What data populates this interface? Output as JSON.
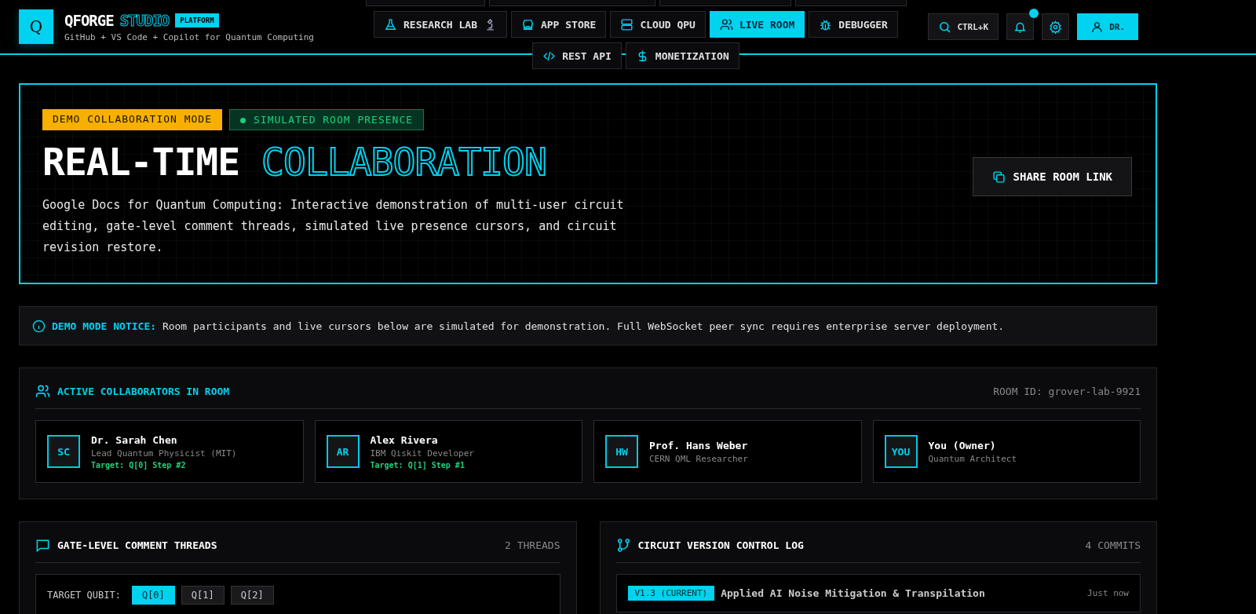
{
  "brand": {
    "logo_letter": "Q",
    "name": "QFORGE",
    "name_accent": "STUDIO",
    "badge": "PLATFORM",
    "tagline": "GitHub + VS Code + Copilot for Quantum Computing"
  },
  "nav_rows": [
    [
      {
        "label": "RESEARCH LAB",
        "selected": false
      },
      {
        "label": "APP STORE",
        "selected": false
      },
      {
        "label": "CLOUD QPU",
        "selected": false
      },
      {
        "label": "LIVE ROOM",
        "selected": true
      },
      {
        "label": "DEBUGGER",
        "selected": false
      }
    ],
    [
      {
        "label": "REST API",
        "selected": false
      },
      {
        "label": "MONETIZATION",
        "selected": false
      }
    ]
  ],
  "header_actions": {
    "search_shortcut": "CTRL+K",
    "notifications_unread": true,
    "user_label": "DR."
  },
  "hero": {
    "badges": [
      {
        "label": "DEMO COLLABORATION MODE",
        "kind": "warning"
      },
      {
        "label": "SIMULATED ROOM PRESENCE",
        "kind": "live"
      }
    ],
    "title": "REAL-TIME",
    "title_accent": "COLLABORATION",
    "description": "Google Docs for Quantum Computing: Interactive demonstration of multi-user circuit editing, gate-level comment threads, simulated live presence cursors, and circuit revision restore.",
    "share_button": "SHARE ROOM LINK"
  },
  "notice": {
    "label": "DEMO MODE NOTICE:",
    "text": "Room participants and live cursors below are simulated for demonstration. Full WebSocket peer sync requires enterprise server deployment."
  },
  "collaborators": {
    "title": "ACTIVE COLLABORATORS IN ROOM",
    "room_id": "ROOM ID: grover-lab-9921",
    "people": [
      {
        "initials": "SC",
        "name": "Dr. Sarah Chen",
        "role": "Lead Quantum Physicist (MIT)",
        "target": "Target: Q[0] Step #2"
      },
      {
        "initials": "AR",
        "name": "Alex Rivera",
        "role": "IBM Qiskit Developer",
        "target": "Target: Q[1] Step #1"
      },
      {
        "initials": "HW",
        "name": "Prof. Hans Weber",
        "role": "CERN QML Researcher"
      },
      {
        "initials": "YOU",
        "name": "You (Owner)",
        "role": "Quantum Architect"
      }
    ]
  },
  "comments": {
    "title": "GATE-LEVEL COMMENT THREADS",
    "count": "2 THREADS",
    "target_label": "TARGET QUBIT:",
    "qubits": [
      {
        "label": "Q[0]",
        "selected": true
      },
      {
        "label": "Q[1]",
        "selected": false
      },
      {
        "label": "Q[2]",
        "selected": false
      }
    ]
  },
  "versions": {
    "title": "CIRCUIT VERSION CONTROL LOG",
    "count": "4 COMMITS",
    "commits": [
      {
        "tag": "V1.3 (CURRENT)",
        "message": "Applied AI Noise Mitigation & Transpilation",
        "time": "Just now"
      }
    ]
  }
}
